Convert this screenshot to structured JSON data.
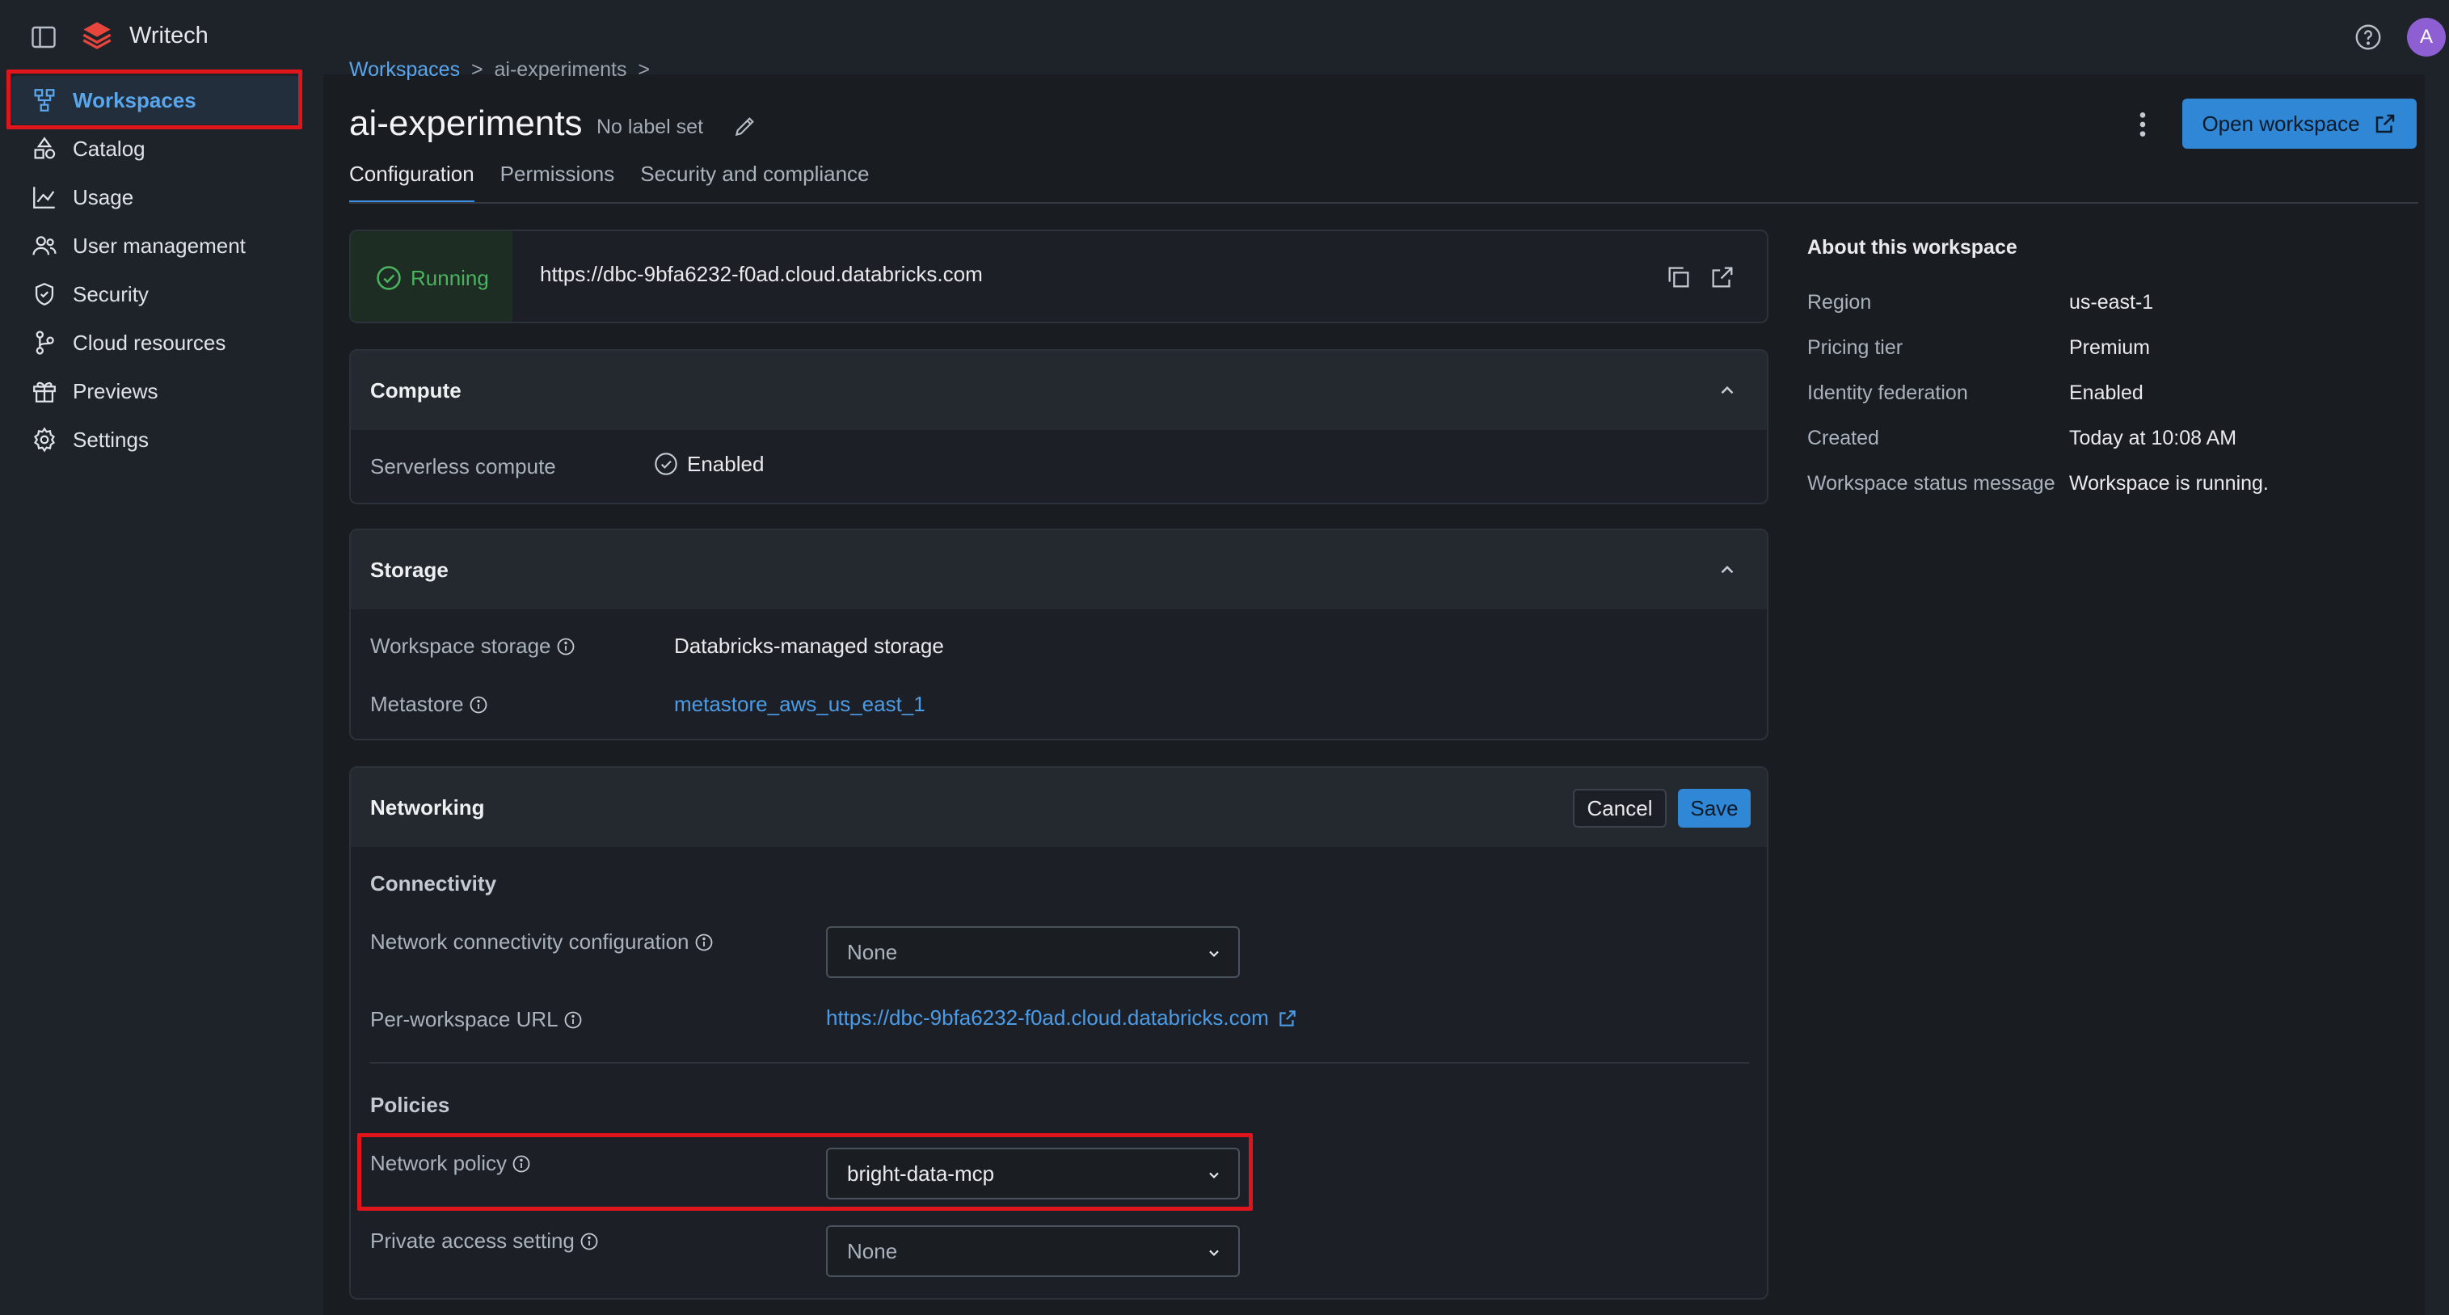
{
  "app": {
    "name": "Writech",
    "avatar_initial": "A"
  },
  "sidebar": {
    "items": [
      {
        "label": "Workspaces",
        "icon": "workspaces-icon",
        "active": true
      },
      {
        "label": "Catalog",
        "icon": "catalog-icon"
      },
      {
        "label": "Usage",
        "icon": "usage-chart-icon"
      },
      {
        "label": "User management",
        "icon": "users-icon"
      },
      {
        "label": "Security",
        "icon": "shield-icon"
      },
      {
        "label": "Cloud resources",
        "icon": "cloud-resources-icon"
      },
      {
        "label": "Previews",
        "icon": "gift-icon"
      },
      {
        "label": "Settings",
        "icon": "gear-icon"
      }
    ]
  },
  "breadcrumb": {
    "root": "Workspaces",
    "current": "ai-experiments",
    "separator": ">"
  },
  "header": {
    "title": "ai-experiments",
    "label": "No label set",
    "open_button": "Open workspace"
  },
  "tabs": [
    "Configuration",
    "Permissions",
    "Security and compliance"
  ],
  "status": {
    "state": "Running",
    "url": "https://dbc-9bfa6232-f0ad.cloud.databricks.com"
  },
  "compute": {
    "title": "Compute",
    "serverless_label": "Serverless compute",
    "serverless_value": "Enabled"
  },
  "storage": {
    "title": "Storage",
    "workspace_storage_label": "Workspace storage",
    "workspace_storage_value": "Databricks-managed storage",
    "metastore_label": "Metastore",
    "metastore_value": "metastore_aws_us_east_1"
  },
  "networking": {
    "title": "Networking",
    "cancel": "Cancel",
    "save": "Save",
    "connectivity_title": "Connectivity",
    "ncc_label": "Network connectivity configuration",
    "ncc_value": "None",
    "url_label": "Per-workspace URL",
    "url_value": "https://dbc-9bfa6232-f0ad.cloud.databricks.com",
    "policies_title": "Policies",
    "network_policy_label": "Network policy",
    "network_policy_value": "bright-data-mcp",
    "private_access_label": "Private access setting",
    "private_access_value": "None"
  },
  "about": {
    "title": "About this workspace",
    "rows": [
      {
        "label": "Region",
        "value": "us-east-1"
      },
      {
        "label": "Pricing tier",
        "value": "Premium"
      },
      {
        "label": "Identity federation",
        "value": "Enabled"
      },
      {
        "label": "Created",
        "value": "Today at 10:08 AM"
      },
      {
        "label": "Workspace status message",
        "value": "Workspace is running."
      }
    ]
  },
  "colors": {
    "accent": "#2f87d6",
    "link": "#4b9be6",
    "running": "#4bb35f",
    "highlight": "#e0151b"
  }
}
